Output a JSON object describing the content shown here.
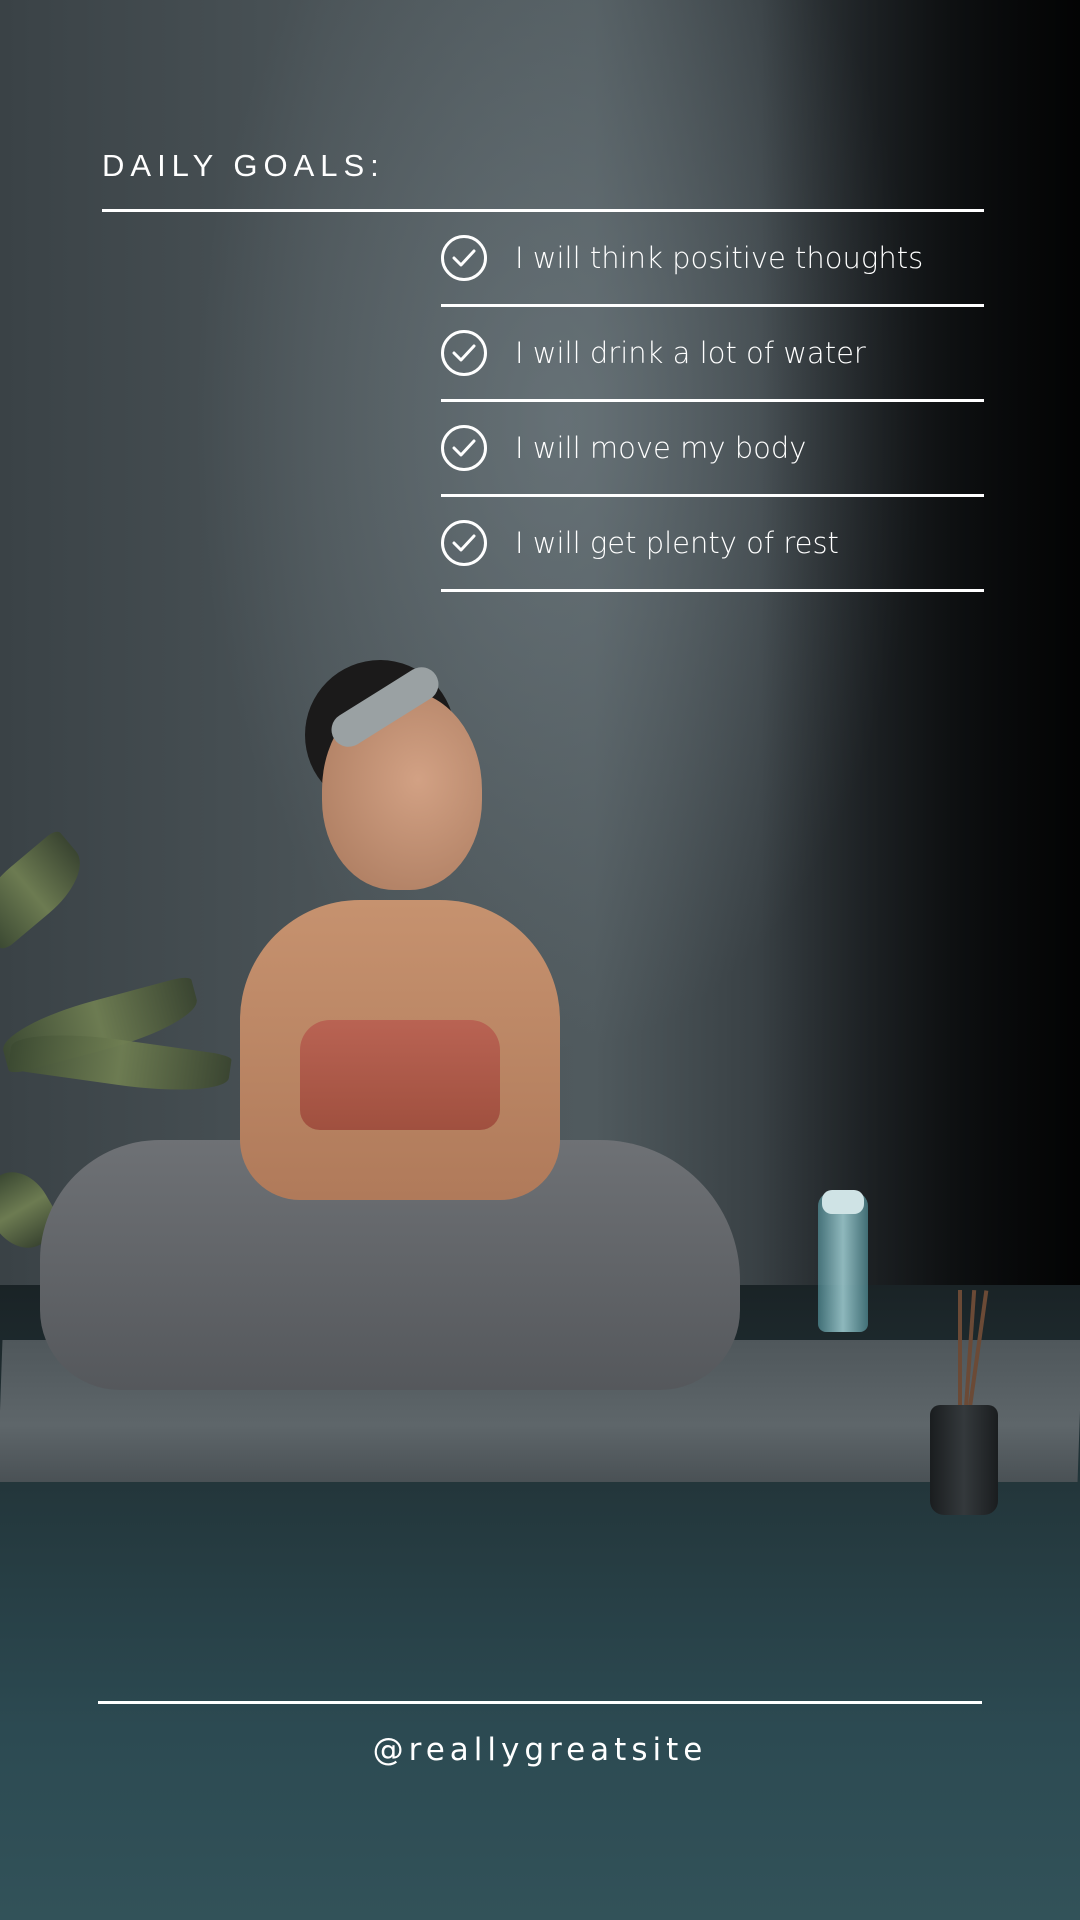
{
  "title": "DAILY GOALS:",
  "goals": [
    {
      "text": "I will think positive thoughts",
      "icon": "check-circle-icon"
    },
    {
      "text": "I will drink a lot of water",
      "icon": "check-circle-icon"
    },
    {
      "text": "I will move my body",
      "icon": "check-circle-icon"
    },
    {
      "text": "I will get plenty of rest",
      "icon": "check-circle-icon"
    }
  ],
  "footer": {
    "handle": "@reallygreatsite"
  },
  "colors": {
    "text": "#ffffff",
    "wall": "#4a5357",
    "floor": "#2c4a52"
  }
}
